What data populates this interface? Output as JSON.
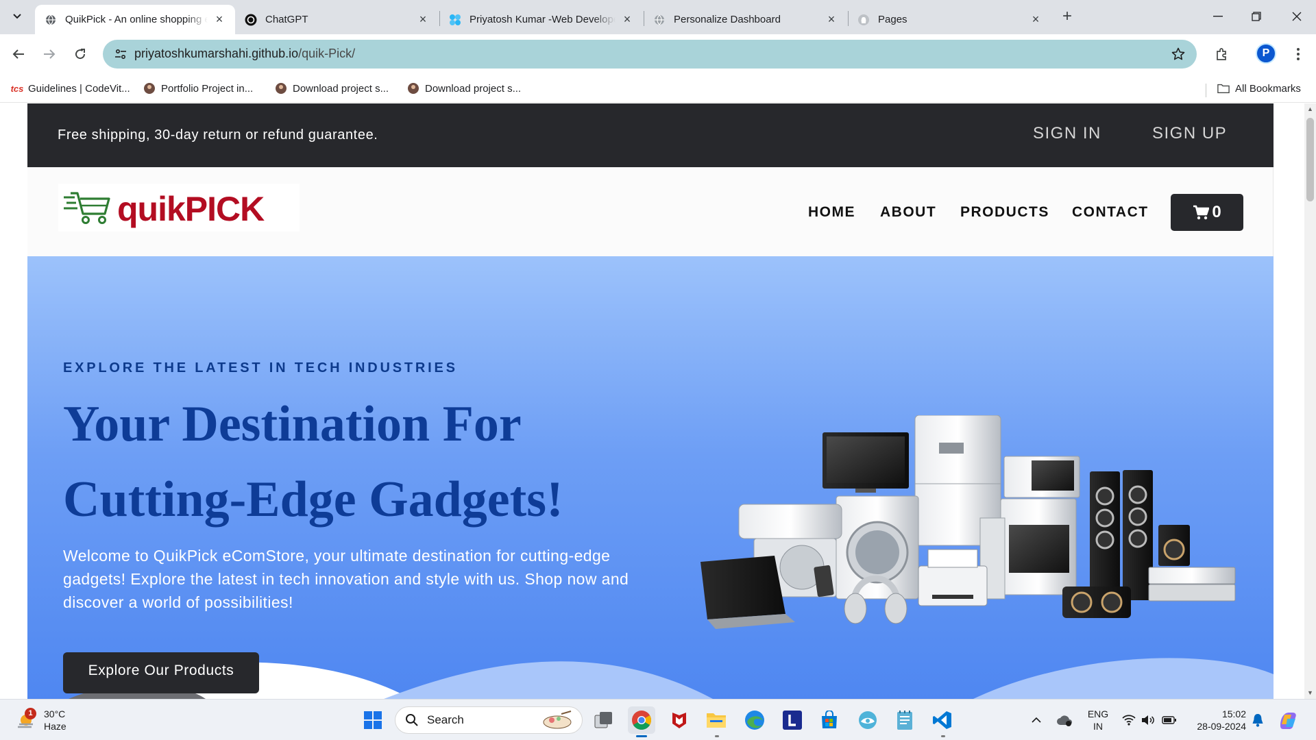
{
  "browser": {
    "tabs": [
      {
        "title": "QuikPick - An online shopping eCommerce",
        "active": true,
        "favicon": "globe-icon"
      },
      {
        "title": "ChatGPT",
        "active": false,
        "favicon": "chatgpt-icon"
      },
      {
        "title": "Priyatosh Kumar -Web Developer",
        "active": false,
        "favicon": "puzzle-icon"
      },
      {
        "title": "Personalize Dashboard",
        "active": false,
        "favicon": "globe-icon"
      },
      {
        "title": "Pages",
        "active": false,
        "favicon": "github-icon"
      }
    ],
    "url_host": "priyatoshkumarshahi.github.io",
    "url_path": "/quik-Pick/",
    "profile_initial": "P",
    "bookmarks": [
      {
        "label": "Guidelines | CodeVit...",
        "icon": "tcs-icon"
      },
      {
        "label": "Portfolio Project in...",
        "icon": "avatar-icon"
      },
      {
        "label": "Download project s...",
        "icon": "avatar-icon"
      },
      {
        "label": "Download project s...",
        "icon": "avatar-icon"
      }
    ],
    "all_bookmarks": "All Bookmarks"
  },
  "site": {
    "promo": {
      "text": "Free shipping, 30-day return or refund guarantee.",
      "sign_in": "SIGN IN",
      "sign_up": "SIGN UP"
    },
    "logo": {
      "text": "quikPICK",
      "icon": "shopping-cart-icon"
    },
    "nav": [
      {
        "label": "HOME"
      },
      {
        "label": "ABOUT"
      },
      {
        "label": "PRODUCTS"
      },
      {
        "label": "CONTACT"
      }
    ],
    "cart_count": "0",
    "hero": {
      "kicker": "EXPLORE THE LATEST IN TECH INDUSTRIES",
      "title_line1": "Your Destination For",
      "title_line2": "Cutting-Edge Gadgets!",
      "description": "Welcome to QuikPick eComStore, your ultimate destination for cutting-edge gadgets! Explore the latest in tech innovation and style with us. Shop now and discover a world of possibilities!",
      "cta": "Explore Our Products",
      "image": "electronics-appliances-image"
    }
  },
  "taskbar": {
    "weather_temp": "30°C",
    "weather_cond": "Haze",
    "weather_badge": "1",
    "search_label": "Search",
    "lang_line1": "ENG",
    "lang_line2": "IN",
    "time": "15:02",
    "date": "28-09-2024",
    "apps": [
      "windows-start-icon",
      "search-icon",
      "task-view-icon",
      "chrome-icon",
      "mcafee-icon",
      "file-explorer-icon",
      "edge-icon",
      "l-app-icon",
      "microsoft-store-icon",
      "app-icon",
      "notepad-icon",
      "vscode-icon"
    ]
  },
  "colors": {
    "promo_bg": "#27282c",
    "logo_red": "#b30d22",
    "hero_title": "#0e3c97",
    "hero_bg_top": "#9cc2fb",
    "hero_bg_bottom": "#4f87f1",
    "omnibox": "#a9d3d9"
  }
}
